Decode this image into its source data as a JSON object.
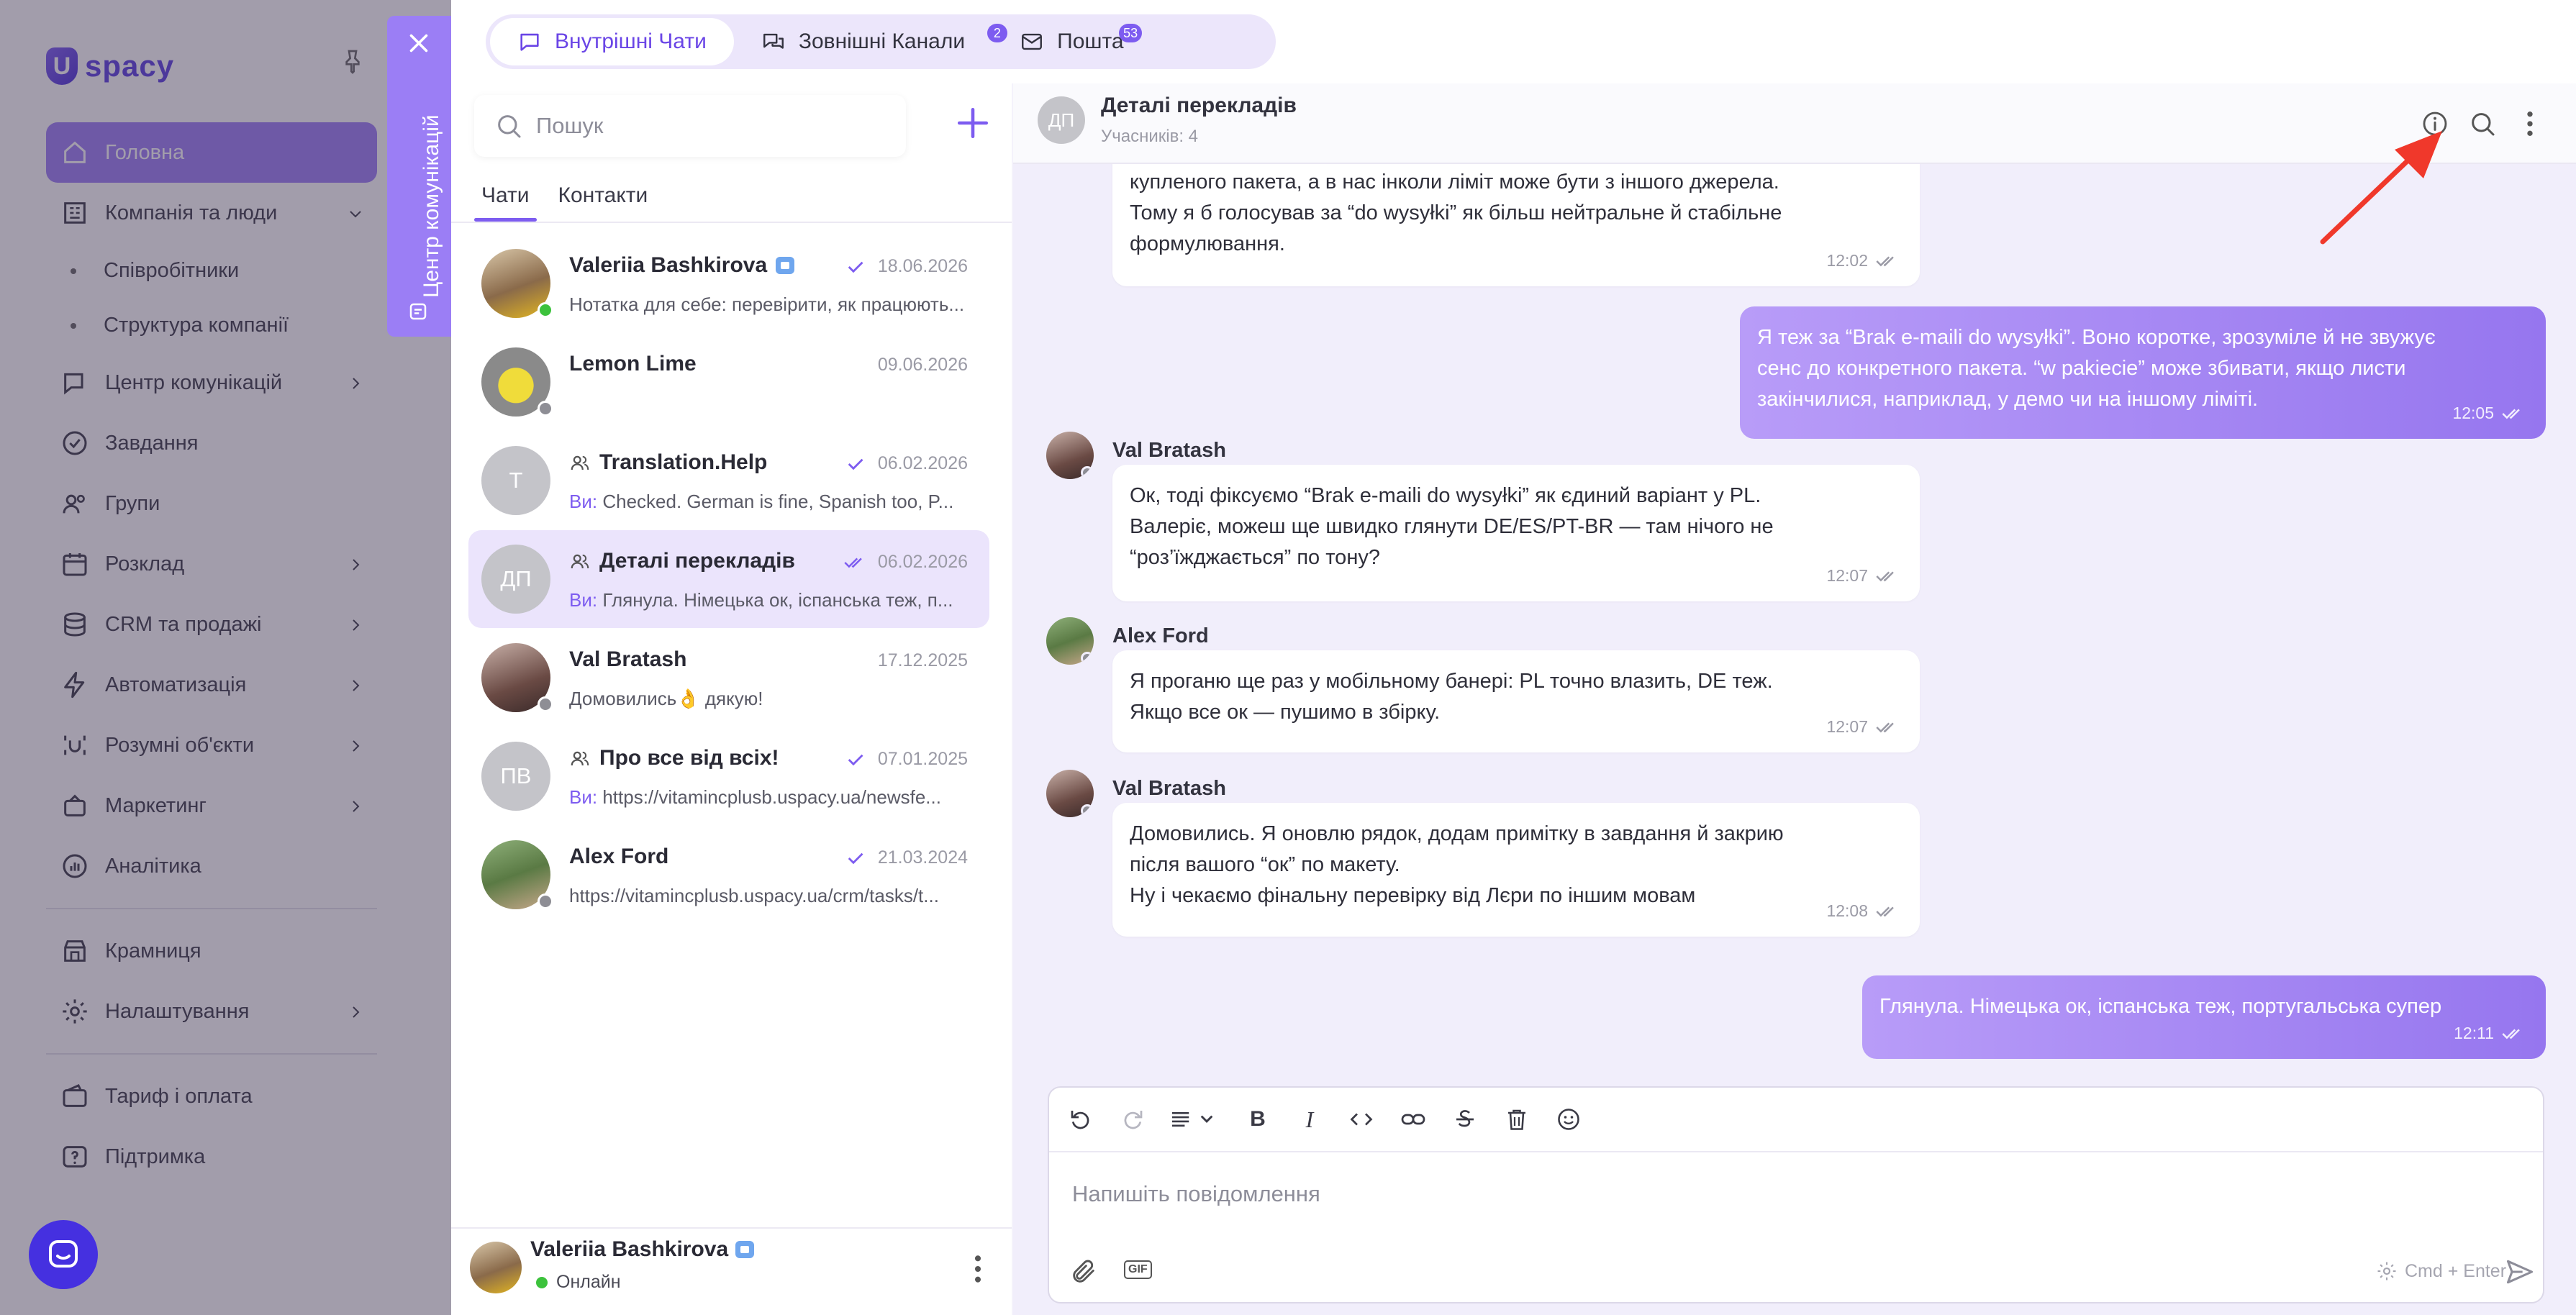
{
  "app_nav": {
    "logo_text": "spacy",
    "logo_letter": "U",
    "items": [
      {
        "label": "Головна",
        "icon": "home-icon",
        "active": true
      },
      {
        "label": "Компанія та люди",
        "icon": "company-icon",
        "expanded": true
      },
      {
        "label": "Співробітники",
        "sub": true
      },
      {
        "label": "Структура компанії",
        "sub": true
      },
      {
        "label": "Центр комунікацій",
        "icon": "chat-icon"
      },
      {
        "label": "Завдання",
        "icon": "check-circle-icon"
      },
      {
        "label": "Групи",
        "icon": "group-icon"
      },
      {
        "label": "Розклад",
        "icon": "calendar-icon"
      },
      {
        "label": "CRM та продажі",
        "icon": "database-icon"
      },
      {
        "label": "Автоматизація",
        "icon": "lightning-icon"
      },
      {
        "label": "Розумні об'єкти",
        "icon": "smart-object-icon"
      },
      {
        "label": "Маркетинг",
        "icon": "marketing-icon"
      },
      {
        "label": "Аналітика",
        "icon": "analytics-icon"
      },
      {
        "label": "Крамниця",
        "icon": "store-icon"
      },
      {
        "label": "Налаштування",
        "icon": "settings-icon"
      },
      {
        "label": "Тариф і оплата",
        "icon": "wallet-icon"
      },
      {
        "label": "Підтримка",
        "icon": "support-icon"
      }
    ]
  },
  "comm_tab": {
    "label": "Центр комунікацій"
  },
  "top_tabs": [
    {
      "label": "Внутрішні Чати",
      "icon": "chat-bubble-icon",
      "active": true,
      "badge": ""
    },
    {
      "label": "Зовнішні Канали",
      "icon": "channels-icon",
      "active": false,
      "badge": "2"
    },
    {
      "label": "Пошта",
      "icon": "mail-icon",
      "active": false,
      "badge": "53"
    }
  ],
  "chat_list": {
    "search_placeholder": "Пошук",
    "tabs": [
      {
        "label": "Чати",
        "active": true
      },
      {
        "label": "Контакти",
        "active": false
      }
    ],
    "items": [
      {
        "name": "Valeriia Bashkirova",
        "date": "18.06.2026",
        "preview": "Нотатка для себе: перевірити, як працюють...",
        "you": "",
        "initials": "",
        "status": "online",
        "verified": true,
        "group": false,
        "read": "single",
        "active": false
      },
      {
        "name": "Lemon Lime",
        "date": "09.06.2026",
        "preview": "",
        "you": "",
        "initials": "",
        "status": "offline",
        "verified": false,
        "group": false,
        "read": "",
        "active": false
      },
      {
        "name": "Translation.Help",
        "date": "06.02.2026",
        "preview": "Checked. German is fine, Spanish too, P...",
        "you": "Ви:",
        "initials": "T",
        "status": "",
        "verified": false,
        "group": true,
        "read": "single",
        "active": false
      },
      {
        "name": "Деталі перекладів",
        "date": "06.02.2026",
        "preview": "Глянула. Німецька ок, іспанська теж, п...",
        "you": "Ви:",
        "initials": "ДП",
        "status": "",
        "verified": false,
        "group": true,
        "read": "double",
        "active": true
      },
      {
        "name": "Val Bratash",
        "date": "17.12.2025",
        "preview": "Домовились👌 дякую!",
        "you": "",
        "initials": "",
        "status": "offline",
        "verified": false,
        "group": false,
        "read": "",
        "active": false
      },
      {
        "name": "Про все від всіх!",
        "date": "07.01.2025",
        "preview": "https://vitamincplusb.uspacy.ua/newsfe...",
        "you": "Ви:",
        "initials": "ПВ",
        "status": "",
        "verified": false,
        "group": true,
        "read": "single",
        "active": false
      },
      {
        "name": "Alex Ford",
        "date": "21.03.2024",
        "preview": "https://vitamincplusb.uspacy.ua/crm/tasks/t...",
        "you": "",
        "initials": "",
        "status": "offline",
        "verified": false,
        "group": false,
        "read": "single",
        "active": false
      }
    ],
    "current_user": {
      "name": "Valeriia Bashkirova",
      "status": "Онлайн"
    }
  },
  "conversation": {
    "title": "Деталі перекладів",
    "initials": "ДП",
    "subtitle": "Учасників: 4",
    "messages": [
      {
        "dir": "in",
        "sender": "",
        "lines": [
          "купленого пакета, а в нас інколи ліміт може бути з іншого джерела.",
          "Тому я б голосував за “do wysyłki” як більш нейтральне й стабільне",
          "формулювання."
        ],
        "time": "12:02"
      },
      {
        "dir": "out",
        "sender": "",
        "lines": [
          "Я теж за “Brak e-maili do wysyłki”. Воно коротке, зрозуміле й не звужує",
          "сенс до конкретного пакета. “w pakiecie” може збивати, якщо листи",
          "закінчилися, наприклад, у демо чи на іншому ліміті."
        ],
        "time": "12:05"
      },
      {
        "dir": "in",
        "sender": "Val Bratash",
        "lines": [
          "Ок, тоді фіксуємо “Brak e-maili do wysyłki” як єдиний варіант у PL.",
          "Валеріє, можеш ще швидко глянути DE/ES/PT-BR — там нічого не",
          "“роз’їжджається” по тону?"
        ],
        "time": "12:07"
      },
      {
        "dir": "in",
        "sender": "Alex Ford",
        "lines": [
          "Я проганю ще раз у мобільному банері: PL точно влазить, DE теж.",
          "Якщо все ок — пушимо в збірку."
        ],
        "time": "12:07"
      },
      {
        "dir": "in",
        "sender": "Val Bratash",
        "lines": [
          "Домовились. Я оновлю рядок, додам примітку в завдання й закрию",
          "після вашого “ок” по макету.",
          "Ну і чекаємо фінальну перевірку від Лєри по іншим мовам"
        ],
        "time": "12:08"
      },
      {
        "dir": "out",
        "sender": "",
        "lines": [
          "Глянула. Німецька ок, іспанська теж, португальська супер"
        ],
        "time": "12:11"
      }
    ],
    "composer": {
      "placeholder": "Напишіть повідомлення",
      "send_hint": "Cmd + Enter",
      "gif_label": "GIF"
    }
  },
  "colors": {
    "accent": "#7d5cf0",
    "active_bg": "#ebe4fc",
    "outgoing_bubble": "#9676ef",
    "online": "#3cc23c",
    "annotation_arrow": "#f0382b"
  }
}
